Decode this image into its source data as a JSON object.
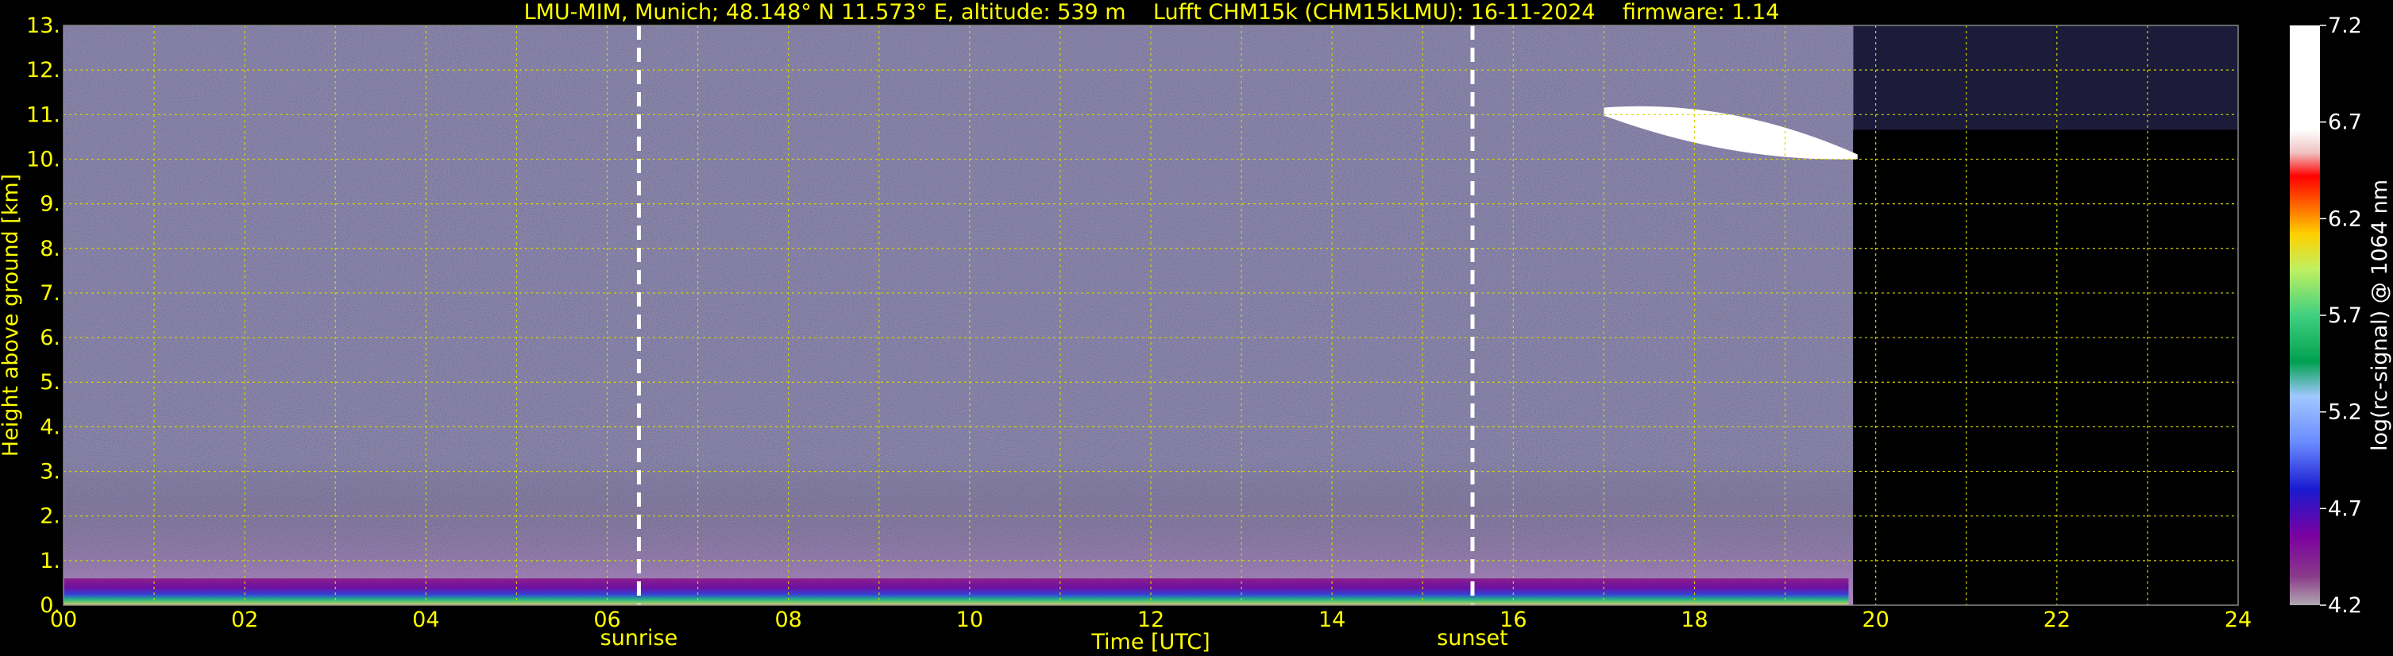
{
  "chart_data": {
    "type": "heatmap",
    "title": "LMU-MIM, Munich; 48.148° N 11.573° E, altitude: 539 m    Lufft CHM15k (CHM15kLMU): 16-11-2024    firmware: 1.14",
    "xlabel": "Time [UTC]",
    "ylabel": "Height above ground [km]",
    "xlim": [
      0,
      24
    ],
    "ylim": [
      0,
      13
    ],
    "x_ticks": [
      "00",
      "02",
      "04",
      "06",
      "08",
      "10",
      "12",
      "14",
      "16",
      "18",
      "20",
      "22",
      "24"
    ],
    "y_ticks": [
      "0.",
      "1.",
      "2.",
      "3.",
      "4.",
      "5.",
      "6.",
      "7.",
      "8.",
      "9.",
      "10.",
      "11.",
      "12.",
      "13."
    ],
    "grid": true,
    "colorbar": {
      "label": "log(rc-signal) @ 1064 nm",
      "range": [
        4.2,
        7.2
      ],
      "ticks": [
        "4.2",
        "4.7",
        "5.2",
        "5.7",
        "6.2",
        "6.7",
        "7.2"
      ]
    },
    "markers": [
      {
        "label": "sunrise",
        "time": 6.35
      },
      {
        "label": "sunset",
        "time": 15.55
      }
    ],
    "layers": [
      {
        "name": "boundary layer",
        "start": 0,
        "end": 19.7,
        "top_km": 0.6
      },
      {
        "name": "cloud",
        "start": 17.0,
        "end": 19.8,
        "base_km": 10.0,
        "top_km": 11.3
      }
    ],
    "data_end_time": 19.75
  },
  "colors": {
    "text": "#ffff00",
    "grid": "#d4d400",
    "background_noise": "#1c1b3a"
  }
}
